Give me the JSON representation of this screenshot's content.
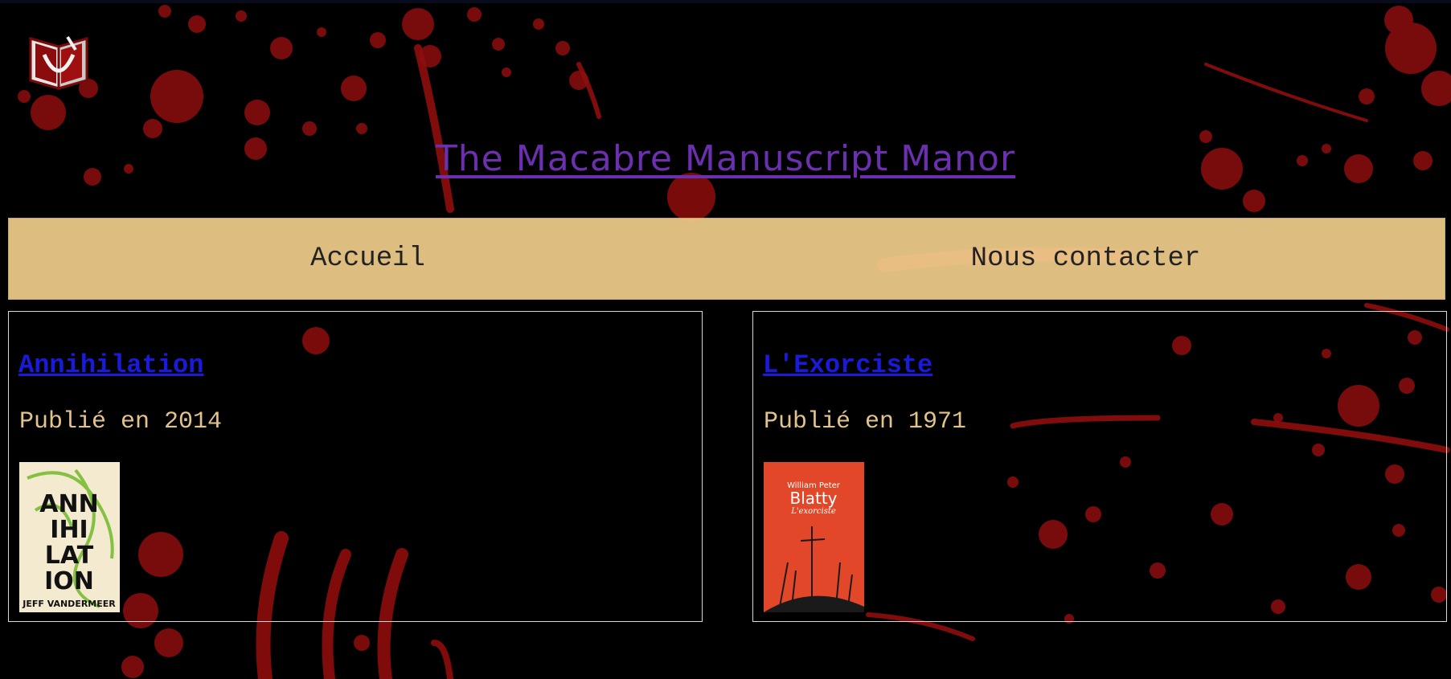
{
  "site": {
    "title": "The Macabre Manuscript Manor",
    "logo_icon": "bleeding-book-logo-icon"
  },
  "nav": {
    "items": [
      {
        "label": "Accueil"
      },
      {
        "label": "Nous contacter"
      }
    ]
  },
  "books": [
    {
      "title": "Annihilation",
      "published": "Publié en 2014",
      "cover": {
        "author": "JEFF VANDERMEER",
        "lines": [
          "ANN",
          "IHI",
          "LAT",
          "ION"
        ],
        "bg": "#f4ead0"
      }
    },
    {
      "title": "L'Exorciste",
      "published": "Publié en 1971",
      "cover": {
        "author_first": "William Peter",
        "author_last": "Blatty",
        "subtitle": "L'exorciste",
        "bg": "#e2472a"
      }
    }
  ],
  "colors": {
    "background": "#000000",
    "nav_bg": "#efcb8b",
    "title": "#6b2fb0",
    "link": "#1a1adc",
    "meta_text": "#e3c38d",
    "blood": "#8e0d0d"
  }
}
